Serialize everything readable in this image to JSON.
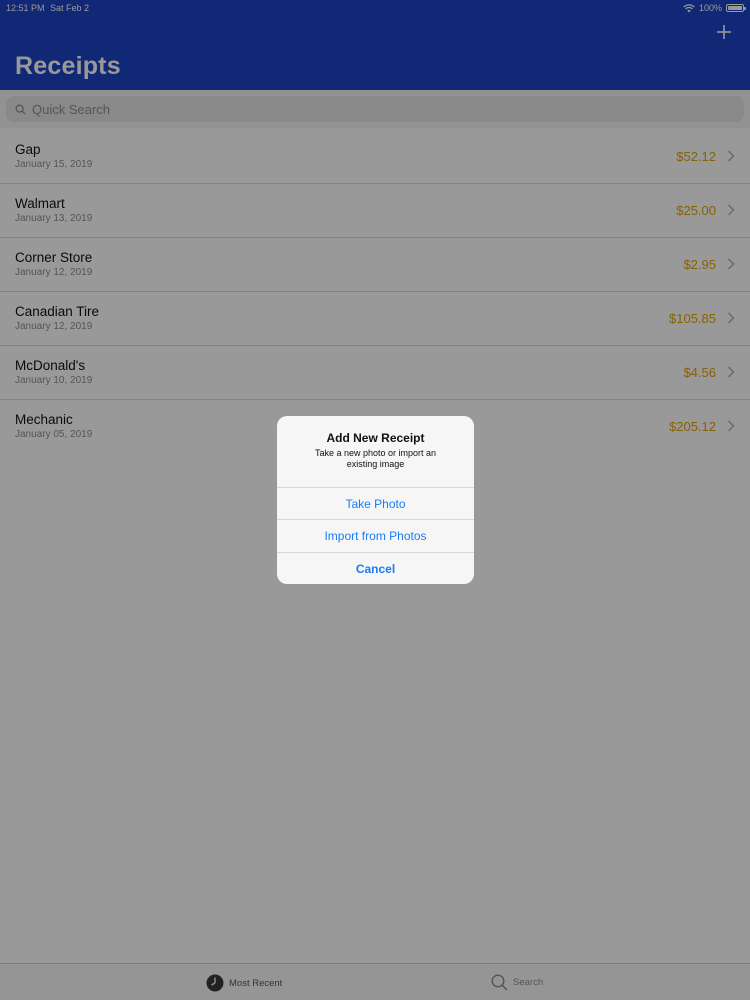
{
  "status_bar": {
    "time": "12:51 PM",
    "date": "Sat Feb 2",
    "battery": "100%"
  },
  "header": {
    "title": "Receipts",
    "add_icon": "plus-icon"
  },
  "search": {
    "placeholder": "Quick Search",
    "icon": "search-icon"
  },
  "receipts": [
    {
      "name": "Gap",
      "date": "January 15, 2019",
      "amount": "$52.12"
    },
    {
      "name": "Walmart",
      "date": "January 13, 2019",
      "amount": "$25.00"
    },
    {
      "name": "Corner Store",
      "date": "January 12, 2019",
      "amount": "$2.95"
    },
    {
      "name": "Canadian Tire",
      "date": "January 12, 2019",
      "amount": "$105.85"
    },
    {
      "name": "McDonald's",
      "date": "January 10, 2019",
      "amount": "$4.56"
    },
    {
      "name": "Mechanic",
      "date": "January 05, 2019",
      "amount": "$205.12"
    }
  ],
  "tabbar": {
    "recent_label": "Most Recent",
    "search_label": "Search"
  },
  "alert": {
    "title": "Add New Receipt",
    "message": "Take a new photo or import an existing image",
    "take_photo": "Take Photo",
    "import_photos": "Import from Photos",
    "cancel": "Cancel"
  },
  "colors": {
    "header": "#1b44c4",
    "amount": "#e2a300",
    "action": "#1a7cf5"
  }
}
